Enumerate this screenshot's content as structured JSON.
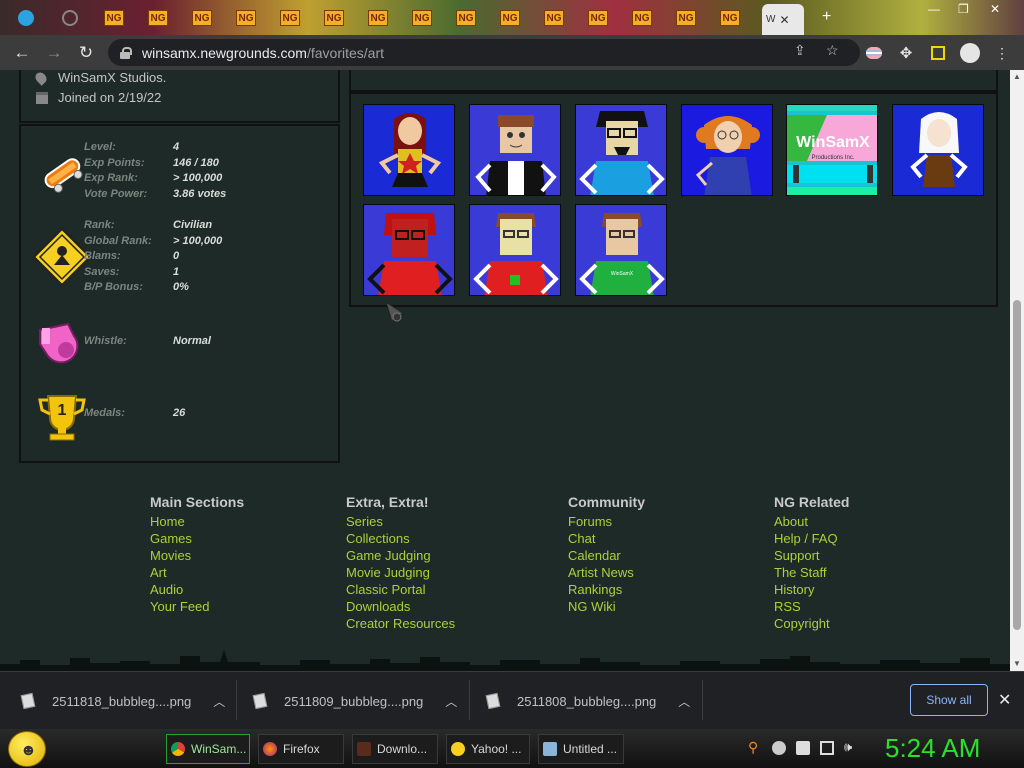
{
  "browser": {
    "tab_ng_label": "NG",
    "active_tab_label": "W",
    "url_host": "winsamx.newgrounds.com",
    "url_path": "/favorites/art"
  },
  "profile": {
    "location": "WinSamX Studios.",
    "joined": "Joined on 2/19/22"
  },
  "stats": {
    "level_label": "Level:",
    "level": "4",
    "exp_points_label": "Exp Points:",
    "exp_points": "146 / 180",
    "exp_rank_label": "Exp Rank:",
    "exp_rank": "> 100,000",
    "vote_power_label": "Vote Power:",
    "vote_power": "3.86 votes",
    "rank_label": "Rank:",
    "rank": "Civilian",
    "global_rank_label": "Global Rank:",
    "global_rank": "> 100,000",
    "blams_label": "Blams:",
    "blams": "0",
    "saves_label": "Saves:",
    "saves": "1",
    "bp_bonus_label": "B/P Bonus:",
    "bp_bonus": "0%",
    "whistle_label": "Whistle:",
    "whistle": "Normal",
    "medals_label": "Medals:",
    "medals": "26",
    "medal_badge_digit": "1"
  },
  "art": {
    "logo_text": "WinSamX",
    "logo_sub": "Productions Inc.",
    "shirt_text": "WinSamX"
  },
  "footer": {
    "main": {
      "title": "Main Sections",
      "links": [
        "Home",
        "Games",
        "Movies",
        "Art",
        "Audio",
        "Your Feed"
      ]
    },
    "extra": {
      "title": "Extra, Extra!",
      "links": [
        "Series",
        "Collections",
        "Game Judging",
        "Movie Judging",
        "Classic Portal",
        "Downloads",
        "Creator Resources"
      ]
    },
    "community": {
      "title": "Community",
      "links": [
        "Forums",
        "Chat",
        "Calendar",
        "Artist News",
        "Rankings",
        "NG Wiki"
      ]
    },
    "related": {
      "title": "NG Related",
      "links": [
        "About",
        "Help / FAQ",
        "Support",
        "The Staff",
        "History",
        "RSS",
        "Copyright"
      ]
    }
  },
  "downloads": {
    "items": [
      "2511818_bubbleg....png",
      "2511809_bubbleg....png",
      "2511808_bubbleg....png"
    ],
    "show_all": "Show all",
    "close": "✕"
  },
  "taskbar": {
    "tasks": [
      "WinSam...",
      "Firefox",
      "Downlo...",
      "Yahoo! ...",
      "Untitled ..."
    ],
    "clock": "5:24 AM"
  }
}
